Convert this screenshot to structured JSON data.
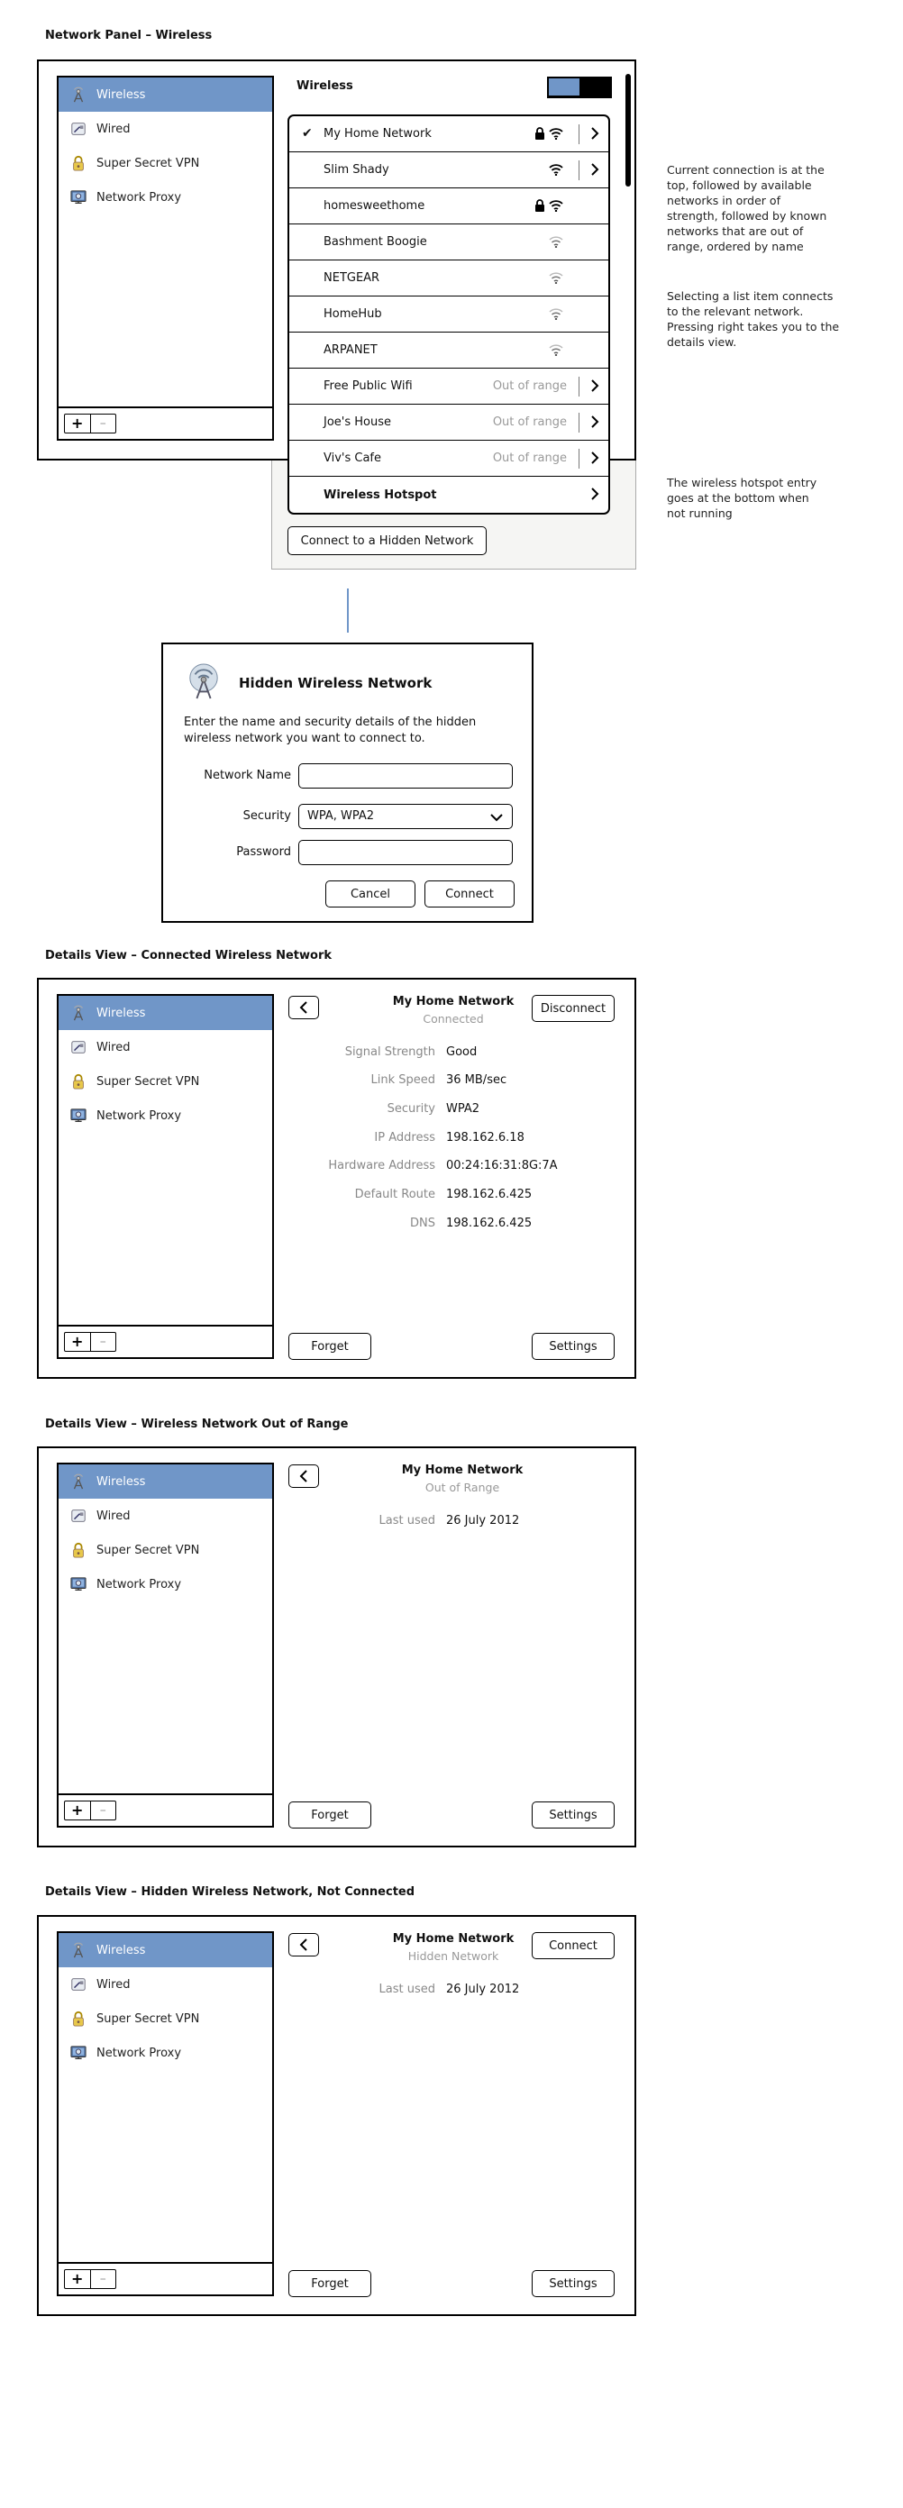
{
  "sections": {
    "network_panel": "Network Panel – Wireless",
    "connected": "Details View – Connected Wireless Network",
    "out_of_range": "Details View – Wireless Network Out of Range",
    "hidden": "Details View – Hidden Wireless Network, Not Connected"
  },
  "sidebar": {
    "items": [
      {
        "label": "Wireless",
        "icon": "wireless-icon"
      },
      {
        "label": "Wired",
        "icon": "wired-icon"
      },
      {
        "label": "Super Secret VPN",
        "icon": "vpn-lock-icon"
      },
      {
        "label": "Network Proxy",
        "icon": "proxy-icon"
      }
    ],
    "add": "+",
    "remove": "–"
  },
  "wireless": {
    "title": "Wireless",
    "toggle_on": true,
    "networks": [
      {
        "name": "My Home Network",
        "connected": true,
        "locked": true,
        "status": "",
        "arrow": true,
        "strength": 3
      },
      {
        "name": "Slim Shady",
        "connected": false,
        "locked": false,
        "status": "",
        "arrow": true,
        "strength": 3
      },
      {
        "name": "homesweethome",
        "connected": false,
        "locked": true,
        "status": "",
        "arrow": false,
        "strength": 3
      },
      {
        "name": "Bashment Boogie",
        "connected": false,
        "locked": false,
        "status": "",
        "arrow": false,
        "strength": 2
      },
      {
        "name": "NETGEAR",
        "connected": false,
        "locked": false,
        "status": "",
        "arrow": false,
        "strength": 2
      },
      {
        "name": "HomeHub",
        "connected": false,
        "locked": false,
        "status": "",
        "arrow": false,
        "strength": 2
      },
      {
        "name": "ARPANET",
        "connected": false,
        "locked": false,
        "status": "",
        "arrow": false,
        "strength": 2
      },
      {
        "name": "Free Public Wifi",
        "connected": false,
        "locked": false,
        "status": "Out of range",
        "arrow": true,
        "strength": 0
      },
      {
        "name": "Joe's House",
        "connected": false,
        "locked": false,
        "status": "Out of range",
        "arrow": true,
        "strength": 0
      },
      {
        "name": "Viv's Cafe",
        "connected": false,
        "locked": false,
        "status": "Out of range",
        "arrow": true,
        "strength": 0
      },
      {
        "name": "Wireless Hotspot",
        "connected": false,
        "locked": false,
        "status": "",
        "arrow": true,
        "strength": 0,
        "bold": true
      }
    ],
    "hidden_button": "Connect to a Hidden Network"
  },
  "notes": {
    "order": "Current connection is at the top, followed by available networks in order of strength, followed by known networks that are out of range, ordered by name",
    "select": "Selecting a list item connects to the relevant network. Pressing right takes you to the details view.",
    "hotspot": "The wireless hotspot entry goes at the bottom when not running"
  },
  "dialog": {
    "title": "Hidden Wireless Network",
    "description": "Enter the name and security details of the hidden wireless network you want to connect to.",
    "network_name_label": "Network Name",
    "network_name_value": "",
    "security_label": "Security",
    "security_value": "WPA, WPA2",
    "password_label": "Password",
    "password_value": "",
    "cancel": "Cancel",
    "connect": "Connect"
  },
  "details_connected": {
    "name": "My Home Network",
    "state": "Connected",
    "action": "Disconnect",
    "rows": [
      {
        "k": "Signal Strength",
        "v": "Good"
      },
      {
        "k": "Link Speed",
        "v": "36 MB/sec"
      },
      {
        "k": "Security",
        "v": "WPA2"
      },
      {
        "k": "IP Address",
        "v": "198.162.6.18"
      },
      {
        "k": "Hardware Address",
        "v": "00:24:16:31:8G:7A"
      },
      {
        "k": "Default Route",
        "v": "198.162.6.425"
      },
      {
        "k": "DNS",
        "v": "198.162.6.425"
      }
    ],
    "forget": "Forget",
    "settings": "Settings"
  },
  "details_out_of_range": {
    "name": "My Home Network",
    "state": "Out of Range",
    "last_used_label": "Last used",
    "last_used": "26 July 2012",
    "forget": "Forget",
    "settings": "Settings"
  },
  "details_hidden": {
    "name": "My Home Network",
    "state": "Hidden Network",
    "action": "Connect",
    "last_used_label": "Last used",
    "last_used": "26 July 2012",
    "forget": "Forget",
    "settings": "Settings"
  },
  "colors": {
    "selection": "#7096c8",
    "connector_line": "#7096c8",
    "muted_text": "#888888"
  }
}
